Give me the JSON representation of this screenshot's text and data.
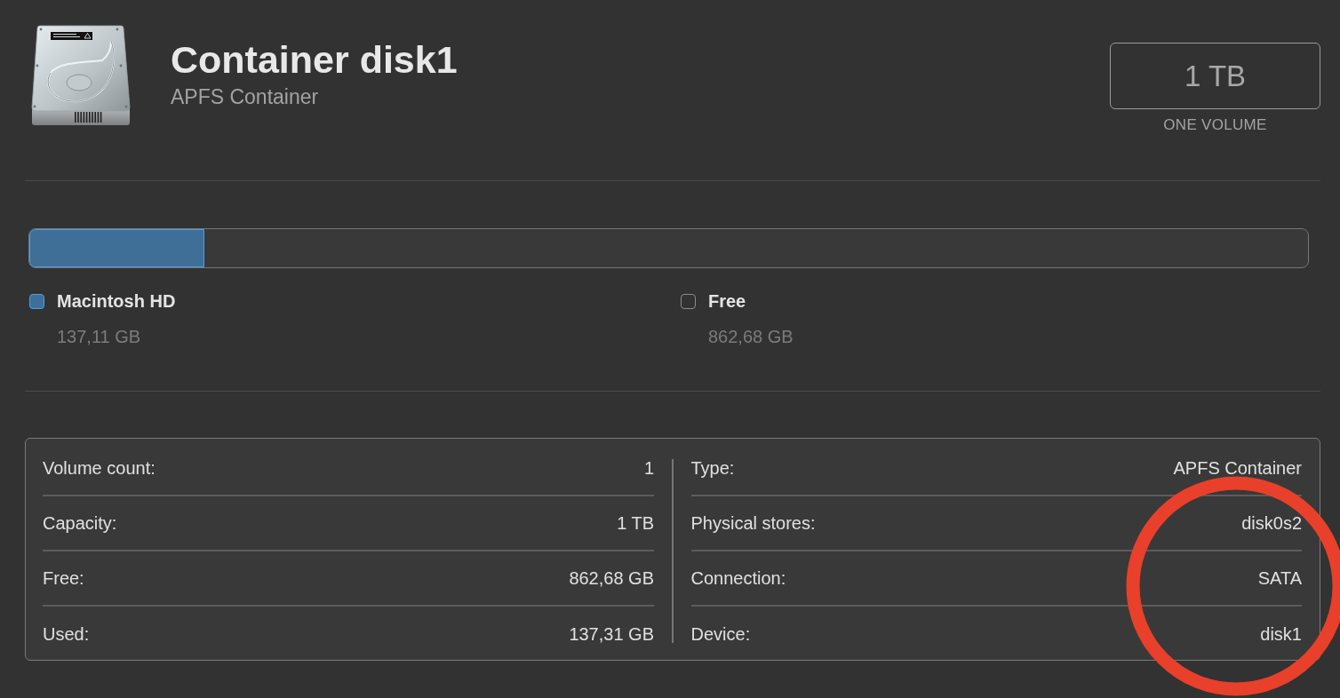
{
  "header": {
    "title": "Container disk1",
    "subtitle": "APFS Container"
  },
  "capacity": {
    "value": "1 TB",
    "caption": "ONE VOLUME"
  },
  "usage": {
    "segments": [
      {
        "kind": "volume",
        "name": "Macintosh HD",
        "size": "137,11 GB",
        "color": "#4aa0e8",
        "level": 0.137
      },
      {
        "kind": "free",
        "name": "Free",
        "size": "862,68 GB",
        "color": "#8c8c8c"
      }
    ]
  },
  "details": {
    "columns": [
      [
        {
          "label": "Volume count:",
          "value": "1"
        },
        {
          "label": "Capacity:",
          "value": "1 TB"
        },
        {
          "label": "Free:",
          "value": "862,68 GB"
        },
        {
          "label": "Used:",
          "value": "137,31 GB"
        }
      ],
      [
        {
          "label": "Type:",
          "value": "APFS Container"
        },
        {
          "label": "Physical stores:",
          "value": "disk0s2"
        },
        {
          "label": "Connection:",
          "value": "SATA"
        },
        {
          "label": "Device:",
          "value": "disk1"
        }
      ]
    ]
  },
  "annotations": [
    {
      "kind": "circle"
    }
  ]
}
